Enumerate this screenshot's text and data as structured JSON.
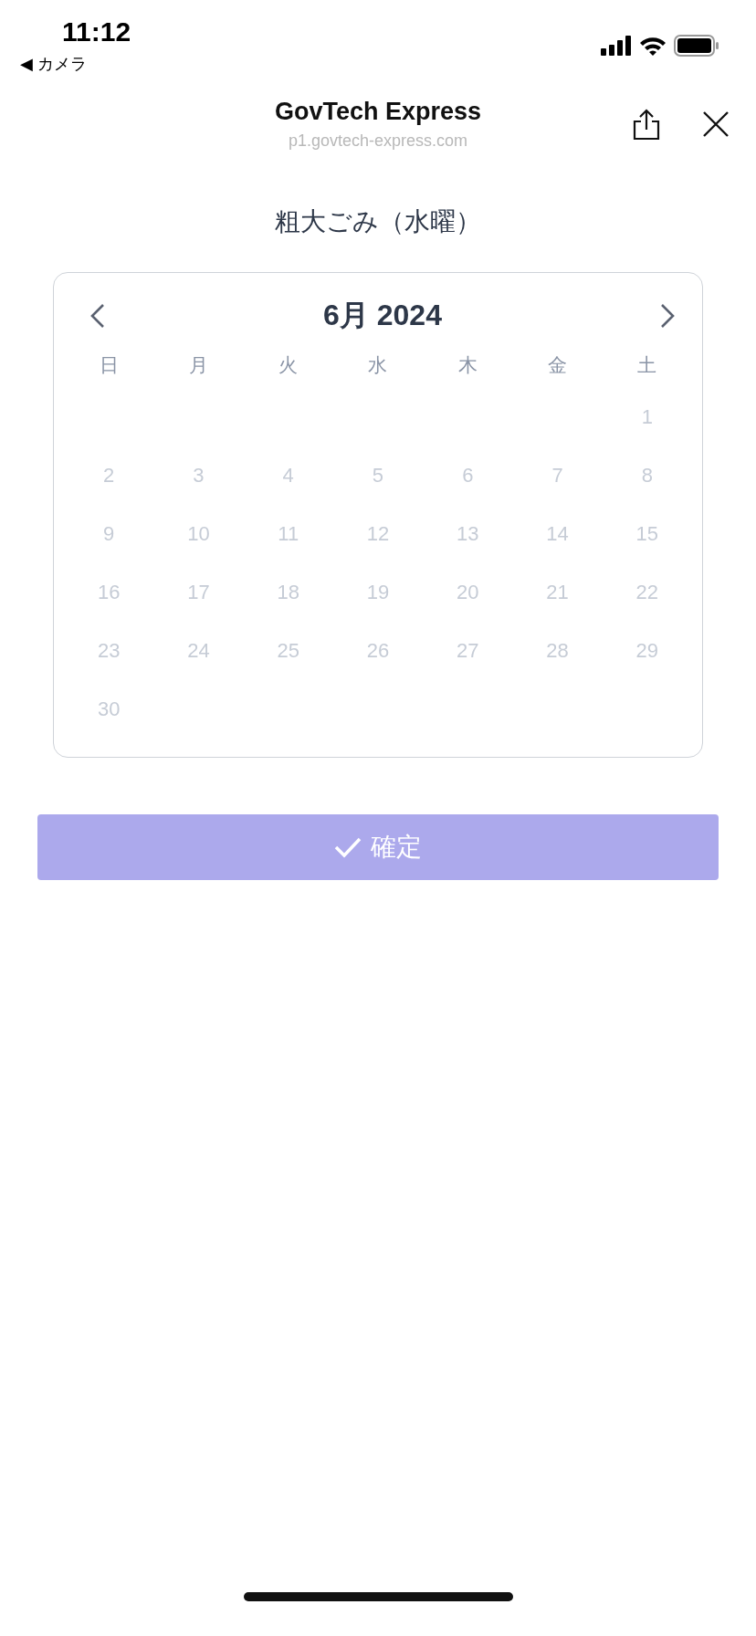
{
  "status_bar": {
    "time": "11:12",
    "back_label": "◀ カメラ"
  },
  "browser_bar": {
    "title": "GovTech Express",
    "url": "p1.govtech-express.com"
  },
  "heading": "粗大ごみ（水曜）",
  "calendar": {
    "month_label": "6月 2024",
    "weekdays": [
      "日",
      "月",
      "火",
      "水",
      "木",
      "金",
      "土"
    ],
    "weeks": [
      [
        {
          "kind": "blank"
        },
        {
          "kind": "blank"
        },
        {
          "kind": "blank"
        },
        {
          "kind": "blank"
        },
        {
          "kind": "blank"
        },
        {
          "kind": "blank"
        },
        {
          "kind": "day",
          "label": "1",
          "disabled": true
        }
      ],
      [
        {
          "kind": "day",
          "label": "2",
          "disabled": true
        },
        {
          "kind": "day",
          "label": "3",
          "disabled": true
        },
        {
          "kind": "day",
          "label": "4",
          "disabled": true
        },
        {
          "kind": "day",
          "label": "5",
          "disabled": true
        },
        {
          "kind": "day",
          "label": "6",
          "disabled": true
        },
        {
          "kind": "day",
          "label": "7",
          "disabled": true
        },
        {
          "kind": "day",
          "label": "8",
          "disabled": true
        }
      ],
      [
        {
          "kind": "day",
          "label": "9",
          "disabled": true
        },
        {
          "kind": "day",
          "label": "10",
          "disabled": true
        },
        {
          "kind": "day",
          "label": "11",
          "disabled": true
        },
        {
          "kind": "day",
          "label": "12",
          "disabled": true
        },
        {
          "kind": "day",
          "label": "13",
          "disabled": true
        },
        {
          "kind": "day",
          "label": "14",
          "disabled": true
        },
        {
          "kind": "day",
          "label": "15",
          "disabled": true
        }
      ],
      [
        {
          "kind": "day",
          "label": "16",
          "disabled": true
        },
        {
          "kind": "day",
          "label": "17",
          "disabled": true
        },
        {
          "kind": "day",
          "label": "18",
          "disabled": true
        },
        {
          "kind": "day",
          "label": "19",
          "disabled": true
        },
        {
          "kind": "day",
          "label": "20",
          "disabled": true
        },
        {
          "kind": "day",
          "label": "21",
          "disabled": true
        },
        {
          "kind": "day",
          "label": "22",
          "disabled": true
        }
      ],
      [
        {
          "kind": "day",
          "label": "23",
          "disabled": true
        },
        {
          "kind": "day",
          "label": "24",
          "disabled": true
        },
        {
          "kind": "day",
          "label": "25",
          "disabled": true
        },
        {
          "kind": "day",
          "label": "26",
          "disabled": true
        },
        {
          "kind": "day",
          "label": "27",
          "disabled": true
        },
        {
          "kind": "day",
          "label": "28",
          "disabled": true
        },
        {
          "kind": "day",
          "label": "29",
          "disabled": true
        }
      ],
      [
        {
          "kind": "day",
          "label": "30",
          "disabled": true
        },
        {
          "kind": "blank"
        },
        {
          "kind": "blank"
        },
        {
          "kind": "blank"
        },
        {
          "kind": "blank"
        },
        {
          "kind": "blank"
        },
        {
          "kind": "blank"
        }
      ]
    ]
  },
  "confirm_button": {
    "label": "確定",
    "disabled": true
  }
}
